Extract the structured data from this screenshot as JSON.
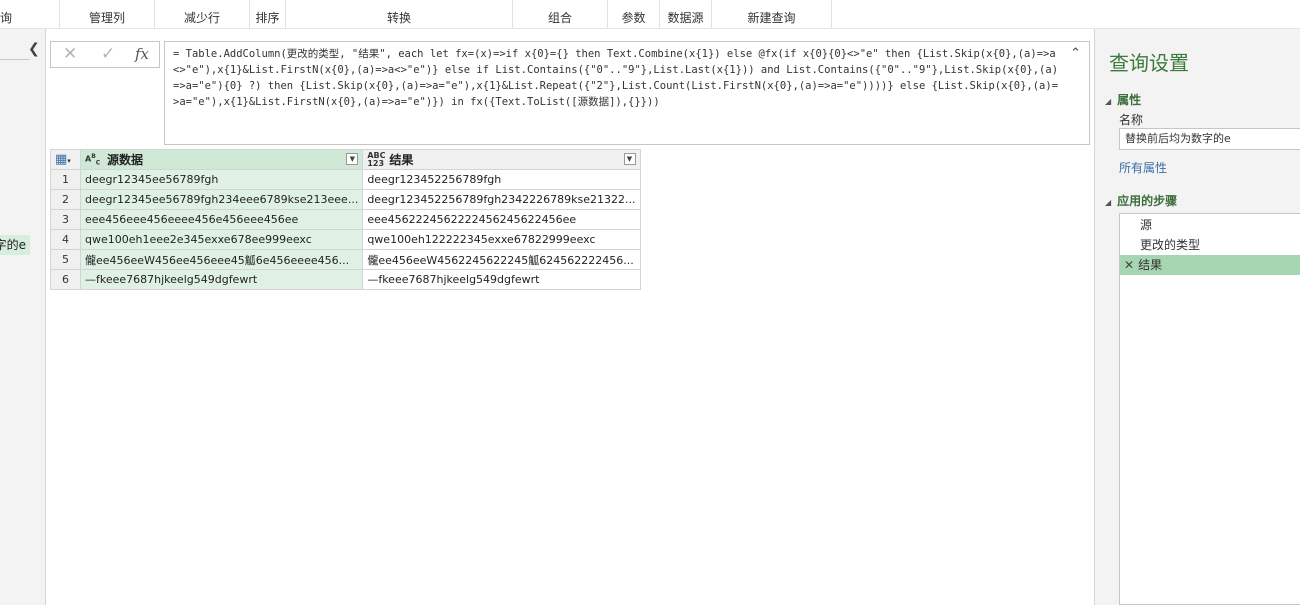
{
  "ribbon": {
    "groups": [
      "询",
      "管理列",
      "减少行",
      "排序",
      "转换",
      "组合",
      "参数",
      "数据源",
      "新建查询"
    ]
  },
  "queries_pane": {
    "collapse_icon": "chevron-left-icon",
    "visible_item_fragment": "字的e"
  },
  "formula_bar": {
    "cancel_icon": "close-icon",
    "confirm_icon": "check-icon",
    "fx_label": "fx",
    "formula": "= Table.AddColumn(更改的类型, \"结果\", each let fx=(x)=>if x{0}={} then Text.Combine(x{1}) else @fx(if x{0}{0}<>\"e\" then {List.Skip(x{0},(a)=>a<>\"e\"),x{1}&List.FirstN(x{0},(a)=>a<>\"e\")} else if List.Contains({\"0\"..\"9\"},List.Last(x{1})) and List.Contains({\"0\"..\"9\"},List.Skip(x{0},(a)=>a=\"e\"){0} ?) then {List.Skip(x{0},(a)=>a=\"e\"),x{1}&List.Repeat({\"2\"},List.Count(List.FirstN(x{0},(a)=>a=\"e\"))))} else {List.Skip(x{0},(a)=>a=\"e\"),x{1}&List.FirstN(x{0},(a)=>a=\"e\")}) in fx({Text.ToList([源数据]),{}}))",
    "collapse_icon": "chevron-up-icon"
  },
  "grid": {
    "table_icon": "table-menu-icon",
    "columns": [
      {
        "type_icon": "ABC",
        "type_icon_sub": "C",
        "name": "源数据"
      },
      {
        "type_icon": "ABC",
        "type_icon_sub": "123",
        "name": "结果"
      }
    ],
    "rows": [
      {
        "n": "1",
        "src": "deegr12345ee56789fgh",
        "res": "deegr123452256789fgh"
      },
      {
        "n": "2",
        "src": "deegr12345ee56789fgh234eee6789kse213eee...",
        "res": "deegr123452256789fgh2342226789kse21322..."
      },
      {
        "n": "3",
        "src": "eee456eee456eeee456e456eee456ee",
        "res": "eee4562224562222456245622456ee"
      },
      {
        "n": "4",
        "src": "qwe100eh1eee2e345exxe678ee999eexc",
        "res": "qwe100eh122222345exxe67822999eexc"
      },
      {
        "n": "5",
        "src": "儱ee456eeW456ee456eee45觚6e456eeee456...",
        "res": "儱ee456eeW4562245622245觚624562222456..."
      },
      {
        "n": "6",
        "src": "—fkeee7687hjkeelg549dgfewrt",
        "res": "—fkeee7687hjkeelg549dgfewrt"
      }
    ]
  },
  "query_settings": {
    "title": "查询设置",
    "properties_header": "属性",
    "name_label": "名称",
    "name_value": "替换前后均为数字的e",
    "all_properties_link": "所有属性",
    "steps_header": "应用的步骤",
    "steps": [
      "源",
      "更改的类型",
      "结果"
    ],
    "selected_step_delete_icon": "close-icon"
  }
}
